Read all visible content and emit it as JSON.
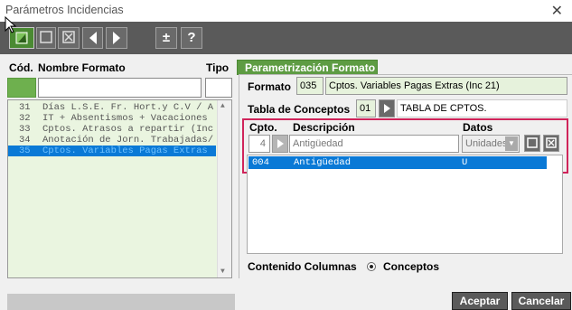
{
  "window": {
    "title": "Parámetros Incidencias",
    "close_glyph": "✕"
  },
  "toolbar": {
    "buttons": [
      {
        "name": "new-icon"
      },
      {
        "name": "blank-square-icon"
      },
      {
        "name": "delete-x-icon"
      },
      {
        "name": "prev-arrow-icon"
      },
      {
        "name": "next-arrow-icon"
      },
      {
        "name": "plus-minus-button",
        "label": "±"
      },
      {
        "name": "help-button",
        "label": "?"
      }
    ]
  },
  "left": {
    "headers": {
      "code": "Cód.",
      "name": "Nombre Formato",
      "type": "Tipo"
    },
    "rows": [
      {
        "code": "31",
        "text": "Días L.S.E. Fr. Hort.y C.V / A"
      },
      {
        "code": "32",
        "text": "IT + Absentismos + Vacaciones"
      },
      {
        "code": "33",
        "text": "Cptos. Atrasos a repartir (Inc"
      },
      {
        "code": "34",
        "text": "Anotación de Jorn. Trabajadas/"
      },
      {
        "code": "35",
        "text": "Cptos. Variables Pagas Extras",
        "selected": true
      }
    ]
  },
  "right": {
    "tab": "Parametrización Formato",
    "formato_label": "Formato",
    "formato_code": "035",
    "formato_name": "Cptos. Variables Pagas Extras (Inc 21)",
    "tabla_label": "Tabla de Conceptos",
    "tabla_code": "01",
    "tabla_name": "TABLA DE CPTOS.",
    "cpto_header": "Cpto.",
    "desc_header": "Descripción",
    "datos_header": "Datos",
    "cpto_value": "4",
    "desc_value": "Antigüedad",
    "datos_value": "Unidades",
    "grid_row": {
      "code": "004",
      "desc": "Antigüedad",
      "datos": "U"
    },
    "contenido_label": "Contenido Columnas",
    "radio_label": "Conceptos"
  },
  "footer": {
    "accept": "Aceptar",
    "cancel": "Cancelar"
  },
  "colors": {
    "toolbar": "#5a5a5a",
    "accent_green": "#5e9c43",
    "selection_blue": "#0a79d6",
    "highlight_frame": "#d0245a",
    "list_bg": "#eaf5e0"
  }
}
